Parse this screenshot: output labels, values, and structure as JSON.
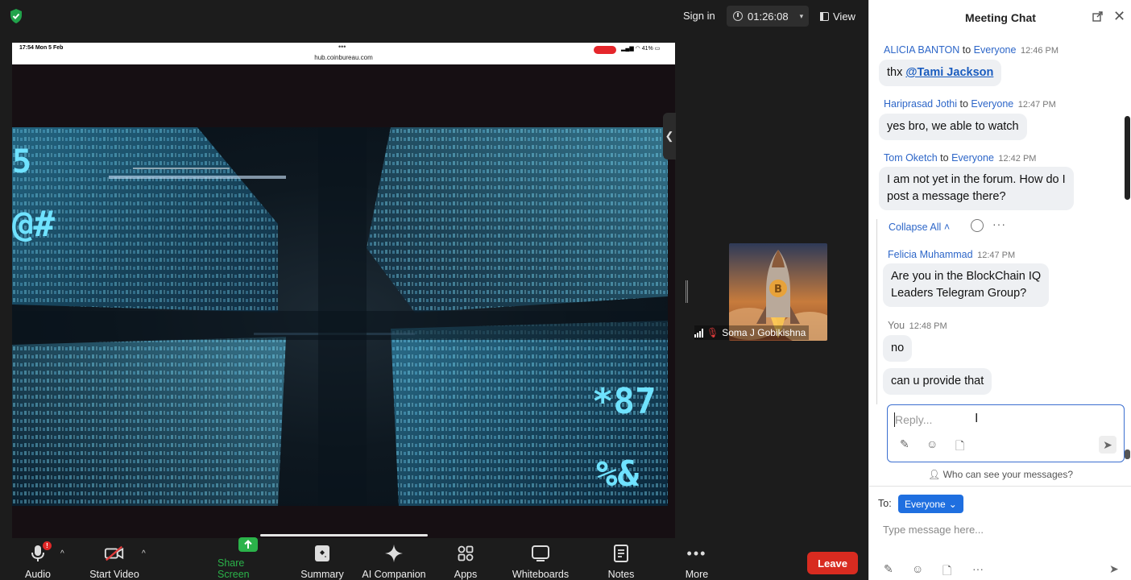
{
  "topbar": {
    "sign_in": "Sign in",
    "timer": "01:26:08",
    "view": "View"
  },
  "shared_screen": {
    "status_time": "17:54  Mon 5 Feb",
    "status_dots": "•••",
    "url": "hub.coinbureau.com",
    "battery": "41%",
    "video_glyphs": [
      "5",
      "@#",
      "*87",
      "%&"
    ]
  },
  "participant": {
    "name": "Soma J Gobikishna",
    "icon": "rocket-bitcoin-avatar"
  },
  "toolbar": {
    "audio": "Audio",
    "audio_badge": "!",
    "start_video": "Start Video",
    "share_screen": "Share Screen",
    "summary": "Summary",
    "ai_companion": "AI Companion",
    "apps": "Apps",
    "whiteboards": "Whiteboards",
    "notes": "Notes",
    "more": "More",
    "leave": "Leave"
  },
  "chat": {
    "title": "Meeting Chat",
    "messages": [
      {
        "sender": "ALICIA BANTON",
        "to": "to",
        "recipient": "Everyone",
        "time": "12:46 PM",
        "text_prefix": "thx ",
        "mention": "@Tami Jackson"
      },
      {
        "sender": "Hariprasad Jothi",
        "to": "to",
        "recipient": "Everyone",
        "time": "12:47 PM",
        "text": "yes bro, we able to watch"
      },
      {
        "sender": "Tom Oketch",
        "to": "to",
        "recipient": "Everyone",
        "time": "12:42 PM",
        "line1": "I am not yet in the forum. How do I",
        "line2": "post a message there?"
      }
    ],
    "collapse_all": "Collapse All",
    "thread": [
      {
        "sender": "Felicia Muhammad",
        "time": "12:47 PM",
        "line1": "Are you in the BlockChain IQ",
        "line2": "Leaders Telegram Group?"
      },
      {
        "sender": "You",
        "time": "12:48 PM",
        "text1": "no",
        "text2": "can u provide that"
      }
    ],
    "reply_placeholder": "Reply...",
    "who_can_see": "Who can see your messages?",
    "to_label": "To:",
    "to_value": "Everyone",
    "type_placeholder": "Type message here..."
  },
  "colors": {
    "accent": "#1f6fe0",
    "leave": "#d82b20",
    "share_green": "#2bb34a",
    "sender_blue": "#2d66c8"
  }
}
